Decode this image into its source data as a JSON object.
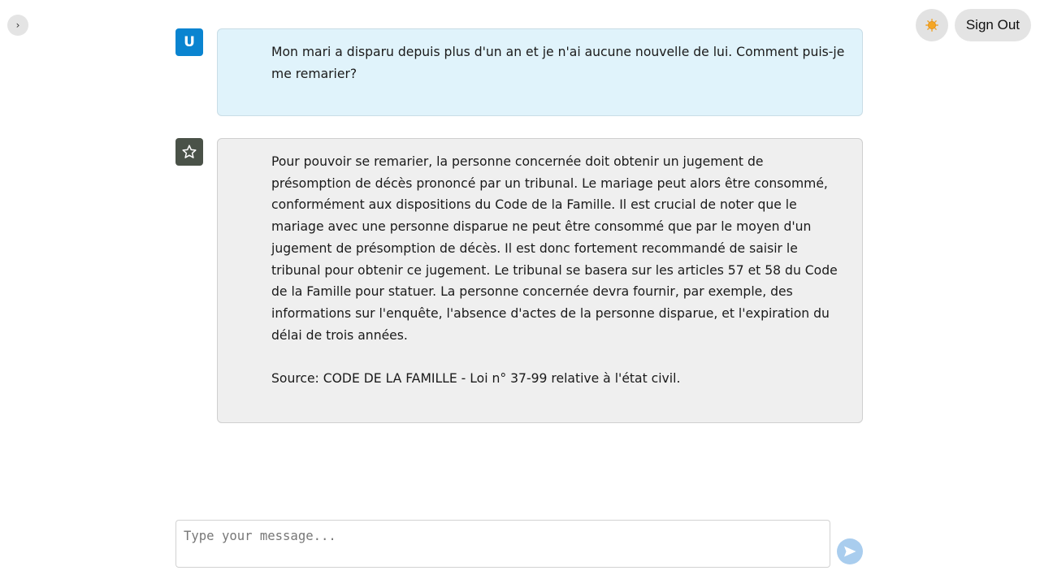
{
  "sidebar": {
    "toggle_glyph": "›",
    "toggle_icon": "chevron-right-icon"
  },
  "header": {
    "theme_icon": "sun-icon",
    "signout_label": "Sign Out"
  },
  "colors": {
    "user_avatar": "#0a84d0",
    "bot_avatar": "#4a5248",
    "user_bubble": "#e0f3fb",
    "bot_bubble": "#efefef",
    "send_button": "#a9cdee"
  },
  "messages": [
    {
      "role": "user",
      "avatar_label": "U",
      "paragraphs": [
        "Mon mari a disparu depuis plus d'un an et je n'ai aucune nouvelle de lui. Comment puis-je me remarier?"
      ]
    },
    {
      "role": "assistant",
      "avatar_icon": "star-icon",
      "paragraphs": [
        "Pour pouvoir se remarier, la personne concernée doit obtenir un jugement de présomption de décès prononcé par un tribunal. Le mariage peut alors être consommé, conformément aux dispositions du Code de la Famille. Il est crucial de noter que le mariage avec une personne disparue ne peut être consommé que par le moyen d'un jugement de présomption de décès. Il est donc fortement recommandé de saisir le tribunal pour obtenir ce jugement. Le tribunal se basera sur les articles 57 et 58 du Code de la Famille pour statuer. La personne concernée devra fournir, par exemple, des informations sur l'enquête, l'absence d'actes de la personne disparue, et l'expiration du délai de trois années.",
        "Source: CODE DE LA FAMILLE - Loi n° 37-99 relative à l'état civil."
      ]
    }
  ],
  "composer": {
    "placeholder": "Type your message...",
    "value": "",
    "send_icon": "send-icon"
  }
}
